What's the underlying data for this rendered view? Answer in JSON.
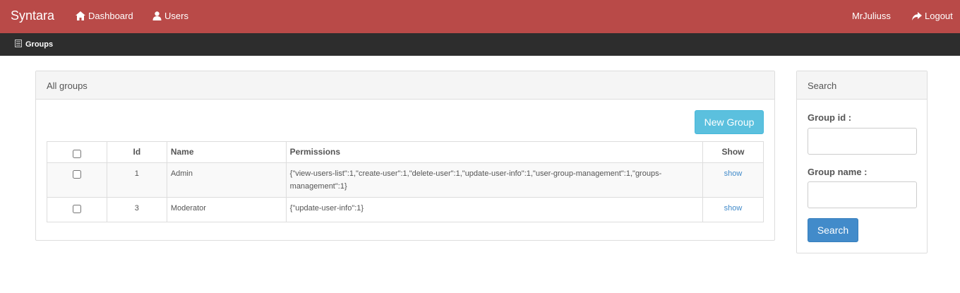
{
  "navbar": {
    "brand": "Syntara",
    "links": [
      {
        "label": "Dashboard",
        "icon": "home-icon"
      },
      {
        "label": "Users",
        "icon": "user-icon"
      }
    ],
    "username": "MrJuliuss",
    "logout": {
      "label": "Logout",
      "icon": "share-arrow-icon"
    },
    "color": "#b94a48"
  },
  "subnav": {
    "items": [
      {
        "label": "Groups",
        "icon": "list-icon"
      }
    ],
    "color": "#2d2d2d"
  },
  "groups_panel": {
    "title": "All groups",
    "new_button": "New Group",
    "table": {
      "headers": [
        "Id",
        "Name",
        "Permissions",
        "Show"
      ],
      "rows": [
        {
          "id": "1",
          "name": "Admin",
          "permissions": "{\"view-users-list\":1,\"create-user\":1,\"delete-user\":1,\"update-user-info\":1,\"user-group-management\":1,\"groups-management\":1}",
          "show": "show"
        },
        {
          "id": "3",
          "name": "Moderator",
          "permissions": "{\"update-user-info\":1}",
          "show": "show"
        }
      ]
    }
  },
  "search_panel": {
    "title": "Search",
    "group_id_label": "Group id :",
    "group_id_value": "",
    "group_name_label": "Group name :",
    "group_name_value": "",
    "button": "Search"
  }
}
